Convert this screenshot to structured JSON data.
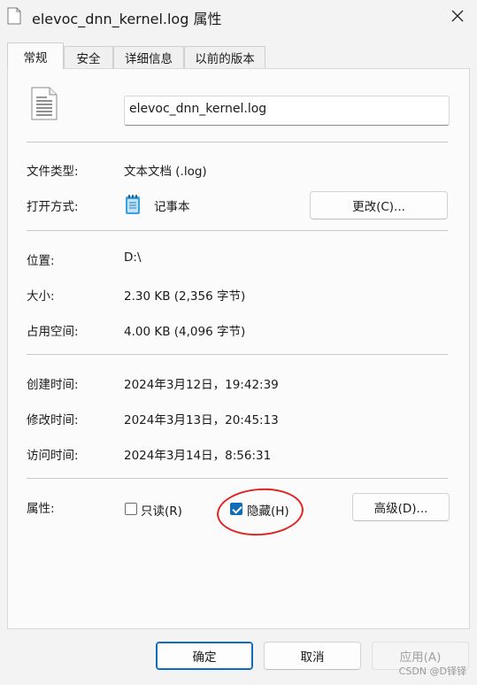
{
  "window": {
    "title": "elevoc_dnn_kernel.log 属性"
  },
  "tabs": [
    {
      "label": "常规",
      "active": true
    },
    {
      "label": "安全"
    },
    {
      "label": "详细信息"
    },
    {
      "label": "以前的版本"
    }
  ],
  "general": {
    "file_name": "elevoc_dnn_kernel.log",
    "type_label": "文件类型:",
    "type_value": "文本文档 (.log)",
    "opens_with_label": "打开方式:",
    "opens_with_value": "记事本",
    "change_button": "更改(C)...",
    "location_label": "位置:",
    "location_value": "D:\\",
    "size_label": "大小:",
    "size_value": "2.30 KB (2,356 字节)",
    "size_on_disk_label": "占用空间:",
    "size_on_disk_value": "4.00 KB (4,096 字节)",
    "created_label": "创建时间:",
    "created_value": "2024年3月12日，19:42:39",
    "modified_label": "修改时间:",
    "modified_value": "2024年3月13日，20:45:13",
    "accessed_label": "访问时间:",
    "accessed_value": "2024年3月14日，8:56:31",
    "attributes_label": "属性:",
    "readonly_label": "只读(R)",
    "hidden_label": "隐藏(H)",
    "readonly_checked": false,
    "hidden_checked": true,
    "advanced_button": "高级(D)..."
  },
  "footer": {
    "ok": "确定",
    "cancel": "取消",
    "apply": "应用(A)"
  },
  "watermark": "CSDN @D铎铎",
  "colors": {
    "accent": "#0f6cbd",
    "annotation": "#e02424"
  }
}
